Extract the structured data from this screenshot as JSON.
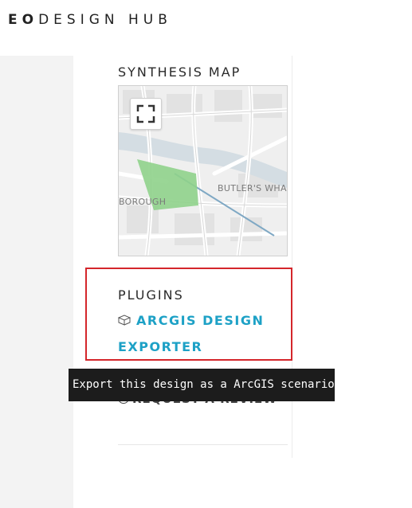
{
  "brand": {
    "bold_part": "EO",
    "light_part": "DESIGN HUB"
  },
  "synthesis_map": {
    "title": "SYNTHESIS MAP",
    "labels": [
      "BUTLER'S WHAR",
      "BOROUGH"
    ],
    "fullscreen_icon": "fullscreen-icon",
    "overlay_color": "#8fd18b",
    "river_color": "#d4dde3"
  },
  "plugins": {
    "title": "PLUGINS",
    "link_line1": "ARCGIS DESIGN",
    "link_line2": "EXPORTER",
    "link_icon": "cube-icon",
    "link_color": "#1da1c6",
    "highlight_color": "#d4262b"
  },
  "review": {
    "label": "REQUEST A REVIEW",
    "icon": "circle-icon"
  },
  "tooltip": {
    "text": "Export this design as a ArcGIS scenario"
  }
}
